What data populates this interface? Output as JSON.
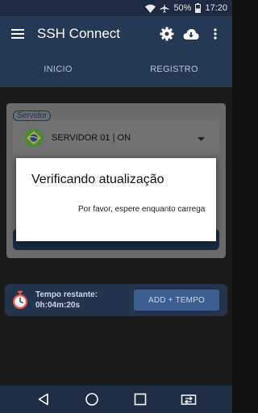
{
  "status_bar": {
    "battery_percent": "50%",
    "time": "17:20",
    "icons": [
      "wifi-icon",
      "airplane-icon",
      "battery-icon"
    ]
  },
  "app_bar": {
    "title": "SSH Connect",
    "icons": [
      "menu-icon",
      "settings-icon",
      "cloud-download-icon",
      "more-vert-icon"
    ]
  },
  "tabs": [
    {
      "label": "INICIO"
    },
    {
      "label": "REGISTRO"
    }
  ],
  "server": {
    "legend": "Servidor",
    "selected": "SERVIDOR 01 | ON",
    "flag_icon": "brazil-flag-icon"
  },
  "dialog": {
    "title": "Verificando atualização",
    "message": "Por favor, espere enquanto carrega"
  },
  "timer": {
    "label": "Tempo restante:",
    "value": "0h:04m:20s",
    "add_button": "ADD + TEMPO"
  },
  "nav_bar": {
    "icons": [
      "back-icon",
      "home-icon",
      "recents-icon",
      "switch-icon"
    ]
  },
  "colors": {
    "primary": "#263954",
    "accent": "#3c5f92",
    "dialog_bg": "#ffffff"
  }
}
